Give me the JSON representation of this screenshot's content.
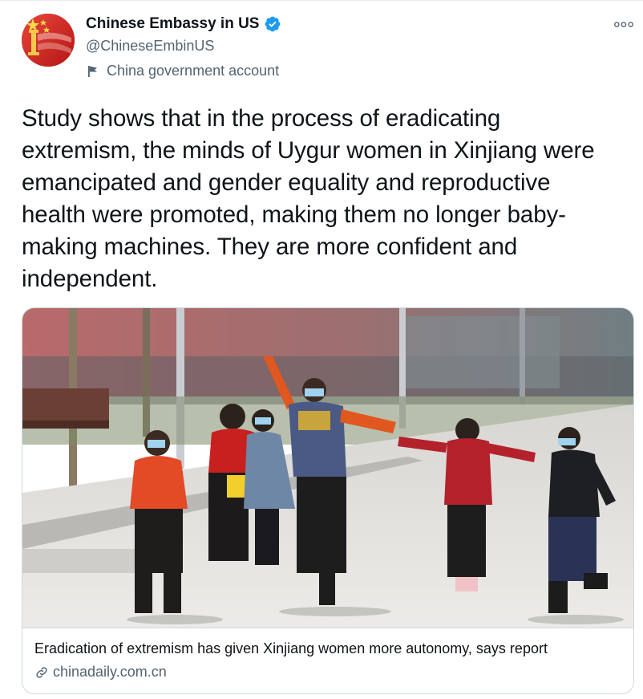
{
  "account": {
    "display_name": "Chinese Embassy in US",
    "handle": "@ChineseEmbinUS",
    "label": "China government account",
    "verified_icon": "verified-badge-icon",
    "label_icon": "flag-icon"
  },
  "menu": {
    "icon": "more-options-icon"
  },
  "tweet": {
    "text": "Study shows that in the process of eradicating\nextremism, the minds of Uygur women in Xinjiang were\nemancipated and gender equality and reproductive\nhealth were promoted, making them no longer baby-\nmaking machines. They are more confident and\nindependent."
  },
  "card": {
    "title": "Eradication of extremism has given Xinjiang women more autonomy, says report",
    "domain": "chinadaily.com.cn",
    "domain_icon": "link-icon"
  },
  "colors": {
    "text_primary": "#0f1419",
    "text_secondary": "#536471",
    "verified_blue": "#1d9bf0",
    "border": "#cfd9de"
  }
}
